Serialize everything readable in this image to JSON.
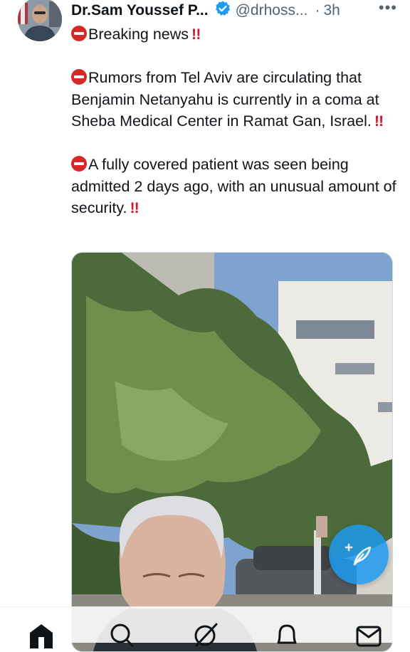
{
  "post": {
    "author_name": "Dr.Sam Youssef P...",
    "handle": "@drhoss...",
    "separator": "·",
    "time": "3h",
    "more_label": "•••",
    "lines": [
      {
        "text": "Breaking news",
        "bangs": "!!"
      },
      {
        "text": "Rumors from Tel Aviv are circulating that Benjamin Netanyahu is currently in a coma at Sheba Medical Center in Ramat Gan, Israel.",
        "bangs": "!!"
      },
      {
        "text": "A fully covered patient was seen being admitted 2 days ago, with an unusual amount of security.",
        "bangs": "!!"
      }
    ]
  },
  "icons": {
    "verified": "verified-badge-icon",
    "line_marker": "no-entry-emoji-icon",
    "compose": "compose-post-icon",
    "nav": [
      "home-icon",
      "search-icon",
      "grok-icon",
      "notifications-icon",
      "messages-icon"
    ]
  },
  "colors": {
    "accent": "#1d9bf0",
    "text": "#0f1419",
    "muted": "#536471",
    "emoji_red": "#d62828"
  }
}
